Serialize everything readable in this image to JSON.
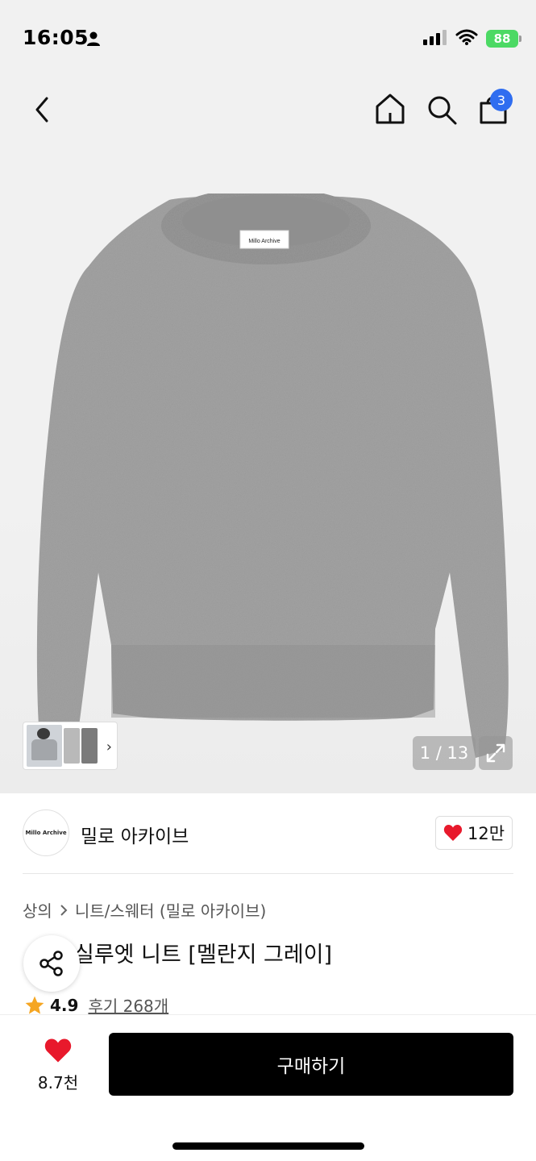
{
  "status_bar": {
    "time": "16:05",
    "battery": "88"
  },
  "nav": {
    "cart_count": "3"
  },
  "gallery": {
    "counter": "1 / 13",
    "tag_text": "Millo Archive"
  },
  "brand": {
    "logo_text": "Millo Archive",
    "name": "밀로 아카이브",
    "likes": "12만"
  },
  "product": {
    "breadcrumb": [
      "상의",
      "니트/스웨터 (밀로 아카이브)"
    ],
    "title": "실루엣 니트 [멜란지 그레이]",
    "rating": "4.9",
    "reviews": "후기 268개"
  },
  "bottom": {
    "wish_count": "8.7천",
    "buy_label": "구매하기"
  },
  "colors": {
    "accent_badge": "#2f6df0",
    "heart": "#e8192c",
    "star": "#f5a623",
    "buy_bg": "#000000"
  }
}
